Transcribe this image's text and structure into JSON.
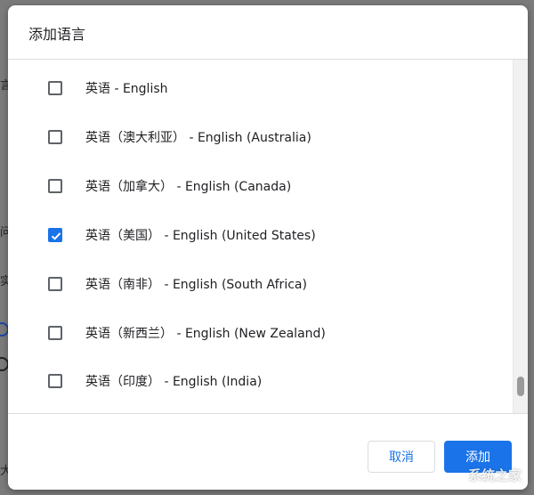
{
  "dialog": {
    "title": "添加语言"
  },
  "languages": [
    {
      "label": "英语 - English",
      "checked": false
    },
    {
      "label": "英语（澳大利亚） - English (Australia)",
      "checked": false
    },
    {
      "label": "英语（加拿大） - English (Canada)",
      "checked": false
    },
    {
      "label": "英语（美国） - English (United States)",
      "checked": true
    },
    {
      "label": "英语（南非） - English (South Africa)",
      "checked": false
    },
    {
      "label": "英语（新西兰） - English (New Zealand)",
      "checked": false
    },
    {
      "label": "英语（印度） - English (India)",
      "checked": false
    }
  ],
  "buttons": {
    "cancel": "取消",
    "add": "添加"
  },
  "background": {
    "frag1": "言",
    "frag2": "问",
    "frag3": "实",
    "frag4": "大"
  },
  "watermark": "系统之家",
  "colors": {
    "accent": "#1a73e8",
    "text": "#202124",
    "divider": "#dadce0"
  },
  "icons": {
    "checkmark": "check-icon"
  }
}
